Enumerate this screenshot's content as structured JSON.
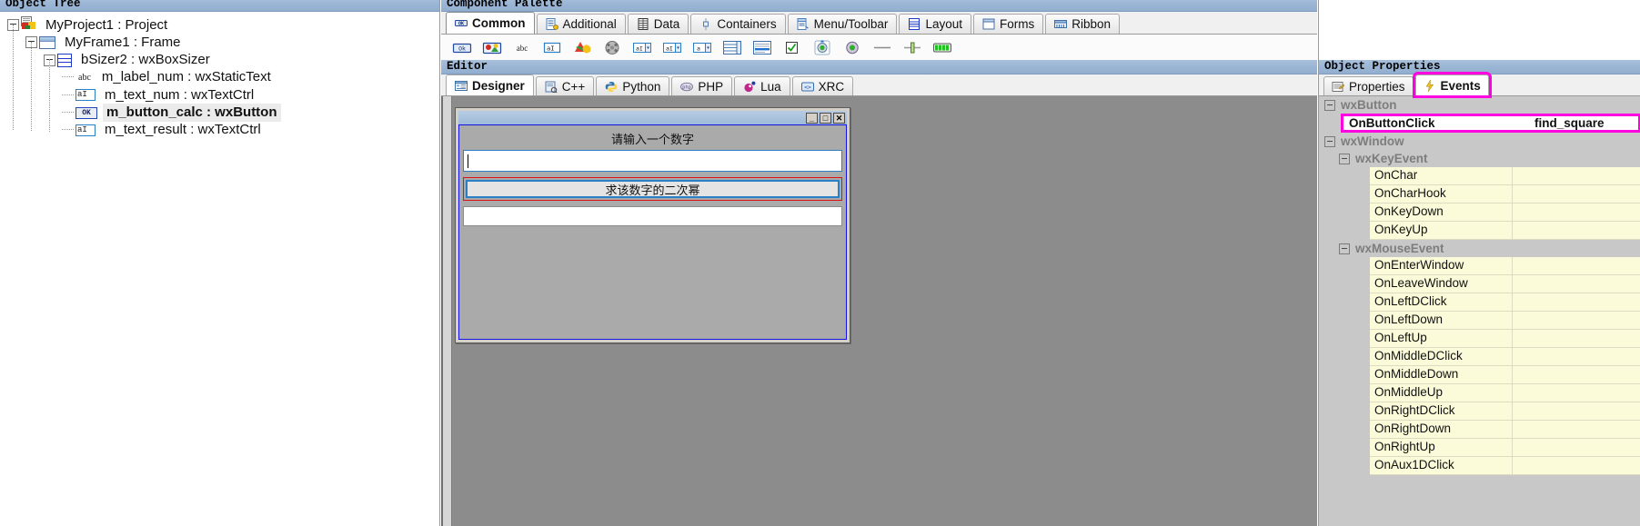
{
  "panels": {
    "object_tree_caption": "Object Tree",
    "component_palette_caption": "Component Palette",
    "editor_caption": "Editor",
    "object_properties_caption": "Object Properties"
  },
  "object_tree": {
    "items": [
      {
        "label": "MyProject1 : Project",
        "icon": "project-icon",
        "depth": 0,
        "selected": false,
        "expander": true
      },
      {
        "label": "MyFrame1 : Frame",
        "icon": "frame-icon",
        "depth": 1,
        "selected": false,
        "expander": true
      },
      {
        "label": "bSizer2 : wxBoxSizer",
        "icon": "boxsizer-icon",
        "depth": 2,
        "selected": false,
        "expander": true
      },
      {
        "label": "m_label_num : wxStaticText",
        "icon": "statictext-icon",
        "depth": 3,
        "selected": false,
        "expander": false
      },
      {
        "label": "m_text_num : wxTextCtrl",
        "icon": "textctrl-icon",
        "depth": 3,
        "selected": false,
        "expander": false
      },
      {
        "label": "m_button_calc : wxButton",
        "icon": "button-icon",
        "depth": 3,
        "selected": true,
        "expander": false
      },
      {
        "label": "m_text_result : wxTextCtrl",
        "icon": "textctrl-icon",
        "depth": 3,
        "selected": false,
        "expander": false
      }
    ],
    "icon_glyphs": {
      "statictext": "abc",
      "textctrl": "aI",
      "button": "OK"
    }
  },
  "component_palette": {
    "tabs": [
      {
        "label": "Common",
        "icon": "button-icon",
        "active": true
      },
      {
        "label": "Additional",
        "icon": "list-icon",
        "active": false
      },
      {
        "label": "Data",
        "icon": "grid-icon",
        "active": false
      },
      {
        "label": "Containers",
        "icon": "splitter-icon",
        "active": false
      },
      {
        "label": "Menu/Toolbar",
        "icon": "menubar-icon",
        "active": false
      },
      {
        "label": "Layout",
        "icon": "boxsizer-icon",
        "active": false
      },
      {
        "label": "Forms",
        "icon": "frame-icon",
        "active": false
      },
      {
        "label": "Ribbon",
        "icon": "ribbon-icon",
        "active": false
      }
    ],
    "tools": [
      "wxbutton-icon",
      "wxbitmapbutton-icon",
      "wxstatictext-icon",
      "wxtextctrl-icon",
      "wxstaticbitmap-icon",
      "wxanimationctrl-icon",
      "wxcombobox-icon",
      "wxchoice-icon",
      "wxbitmapcombobox-icon",
      "wxlistbox-icon",
      "wxrichtextctrl-icon",
      "wxcheckbox-icon",
      "wxradiobutton-icon",
      "wxtogglebutton-icon",
      "wxstaticline-icon",
      "wxslider-icon",
      "wxgauge-icon"
    ]
  },
  "editor": {
    "tabs": [
      {
        "label": "Designer",
        "icon": "designer-icon",
        "active": true
      },
      {
        "label": "C++",
        "icon": "cpp-icon",
        "active": false
      },
      {
        "label": "Python",
        "icon": "python-icon",
        "active": false
      },
      {
        "label": "PHP",
        "icon": "php-icon",
        "active": false
      },
      {
        "label": "Lua",
        "icon": "lua-icon",
        "active": false
      },
      {
        "label": "XRC",
        "icon": "xrc-icon",
        "active": false
      }
    ]
  },
  "designer": {
    "window_buttons": [
      {
        "name": "minimize-button",
        "glyph": "_"
      },
      {
        "name": "maximize-button",
        "glyph": "□"
      },
      {
        "name": "close-button",
        "glyph": "✕"
      }
    ],
    "static_text": "请输入一个数字",
    "text_input_value": "",
    "button_label": "求该数字的二次幂",
    "result_input_value": "",
    "selection_color": "#e01010",
    "sizer_outline_color": "#1414e6",
    "canvas_color": "#8c8c8c"
  },
  "object_properties": {
    "tabs": [
      {
        "label": "Properties",
        "icon": "properties-icon",
        "active": false,
        "highlight": false
      },
      {
        "label": "Events",
        "icon": "lightning-icon",
        "active": true,
        "highlight": true
      }
    ],
    "highlight_color": "#ff00e0",
    "groups": [
      {
        "name": "wxButton",
        "indent": 0,
        "rows": [
          {
            "name": "OnButtonClick",
            "value": "find_square",
            "highlight": true
          }
        ],
        "subgroups": []
      },
      {
        "name": "wxWindow",
        "indent": 0,
        "rows": [],
        "subgroups": [
          {
            "name": "wxKeyEvent",
            "indent": 1,
            "rows": [
              {
                "name": "OnChar",
                "value": "",
                "highlight": false
              },
              {
                "name": "OnCharHook",
                "value": "",
                "highlight": false
              },
              {
                "name": "OnKeyDown",
                "value": "",
                "highlight": false
              },
              {
                "name": "OnKeyUp",
                "value": "",
                "highlight": false
              }
            ]
          },
          {
            "name": "wxMouseEvent",
            "indent": 1,
            "rows": [
              {
                "name": "OnEnterWindow",
                "value": "",
                "highlight": false
              },
              {
                "name": "OnLeaveWindow",
                "value": "",
                "highlight": false
              },
              {
                "name": "OnLeftDClick",
                "value": "",
                "highlight": false
              },
              {
                "name": "OnLeftDown",
                "value": "",
                "highlight": false
              },
              {
                "name": "OnLeftUp",
                "value": "",
                "highlight": false
              },
              {
                "name": "OnMiddleDClick",
                "value": "",
                "highlight": false
              },
              {
                "name": "OnMiddleDown",
                "value": "",
                "highlight": false
              },
              {
                "name": "OnMiddleUp",
                "value": "",
                "highlight": false
              },
              {
                "name": "OnRightDClick",
                "value": "",
                "highlight": false
              },
              {
                "name": "OnRightDown",
                "value": "",
                "highlight": false
              },
              {
                "name": "OnRightUp",
                "value": "",
                "highlight": false
              },
              {
                "name": "OnAux1DClick",
                "value": "",
                "highlight": false
              }
            ]
          }
        ]
      }
    ]
  }
}
